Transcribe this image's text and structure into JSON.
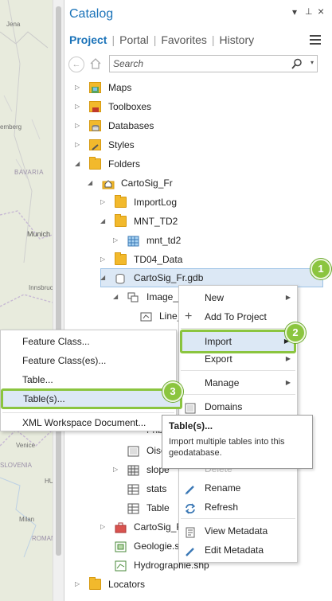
{
  "map": {
    "labels": [
      "Jena",
      "emberg",
      "BAVARIA",
      "Munich",
      "Innsbruck",
      "Venice",
      "Milan",
      "ROMANIA",
      "HU",
      "SLOVENIA"
    ]
  },
  "catalog": {
    "title": "Catalog",
    "controls": {
      "dropdown": "▾",
      "pin": "⊥",
      "close": "×"
    },
    "tabs": [
      "Project",
      "Portal",
      "Favorites",
      "History"
    ],
    "search_placeholder": "Search"
  },
  "tree": {
    "maps": "Maps",
    "toolboxes": "Toolboxes",
    "databases": "Databases",
    "styles": "Styles",
    "folders": "Folders",
    "cartosig_fr": "CartoSig_Fr",
    "importlog": "ImportLog",
    "mnt_td2": "MNT_TD2",
    "mnt_td2_raster": "mnt_td2",
    "td04_data": "TD04_Data",
    "gdb": "CartoSig_Fr.gdb",
    "image_partial": "Image_M",
    "line_partial": "Line_",
    "fribourg_partial": "Frib",
    "oise_partial": "Oise",
    "slope_partial": "slope",
    "stats": "stats",
    "table": "Table",
    "cartosig_f_partial": "CartoSig_F",
    "geologie_partial": "Geologie.sh",
    "hydrographie": "Hydrographie.shp",
    "locators": "Locators"
  },
  "context_menu": {
    "new": "New",
    "add_to_project": "Add To Project",
    "import": "Import",
    "export": "Export",
    "manage": "Manage",
    "domains": "Domains",
    "delete_partial": "Delete",
    "rename": "Rename",
    "refresh": "Refresh",
    "view_metadata": "View Metadata",
    "edit_metadata": "Edit Metadata"
  },
  "import_submenu": {
    "feature_class": "Feature Class...",
    "feature_classes": "Feature Class(es)...",
    "table": "Table...",
    "tables": "Table(s)...",
    "xml_workspace": "XML Workspace Document..."
  },
  "tooltip": {
    "title": "Table(s)...",
    "body": "Import multiple tables into this geodatabase."
  },
  "callouts": [
    "1",
    "2",
    "3"
  ],
  "colors": {
    "accent": "#1b73b9",
    "callout": "#8bc53f",
    "selection": "#dce8f5",
    "folder": "#f2b92c"
  }
}
